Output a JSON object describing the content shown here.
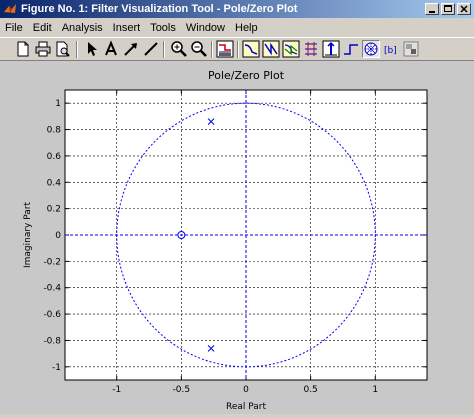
{
  "window": {
    "title": "Figure No. 1: Filter Visualization Tool - Pole/Zero Plot"
  },
  "menu": [
    "File",
    "Edit",
    "Analysis",
    "Insert",
    "Tools",
    "Window",
    "Help"
  ],
  "toolbar": {
    "icons": [
      "new-file-icon",
      "print-icon",
      "print-preview-icon",
      "pointer-icon",
      "text-icon",
      "arrow-icon",
      "line-icon",
      "zoom-in-icon",
      "zoom-out-icon",
      "filter-specs-icon",
      "magnitude-response-icon",
      "phase-response-icon",
      "mag-phase-icon",
      "group-delay-icon",
      "impulse-response-icon",
      "step-response-icon",
      "pole-zero-icon",
      "filter-coefficients-icon",
      "filter-info-icon"
    ]
  },
  "chart_data": {
    "type": "scatter",
    "title": "Pole/Zero Plot",
    "xlabel": "Real Part",
    "ylabel": "Imaginary Part",
    "xlim": [
      -1.4,
      1.4
    ],
    "ylim": [
      -1.1,
      1.1
    ],
    "xticks": [
      -1,
      -0.5,
      0,
      0.5,
      1
    ],
    "yticks": [
      -1,
      -0.8,
      -0.6,
      -0.4,
      -0.2,
      0,
      0.2,
      0.4,
      0.6,
      0.8,
      1
    ],
    "grid": true,
    "unit_circle": true,
    "zeros": [
      {
        "x": -0.5,
        "y": 0
      }
    ],
    "poles": [
      {
        "x": -0.27,
        "y": 0.86
      },
      {
        "x": -0.27,
        "y": -0.86
      }
    ],
    "color": "#0000ff"
  }
}
